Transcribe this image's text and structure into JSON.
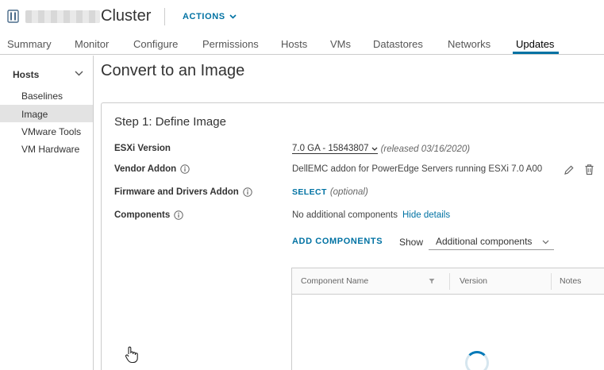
{
  "header": {
    "title": "Cluster",
    "actions_label": "ACTIONS"
  },
  "tabs": [
    {
      "label": "Summary"
    },
    {
      "label": "Monitor"
    },
    {
      "label": "Configure"
    },
    {
      "label": "Permissions"
    },
    {
      "label": "Hosts"
    },
    {
      "label": "VMs"
    },
    {
      "label": "Datastores"
    },
    {
      "label": "Networks"
    },
    {
      "label": "Updates",
      "active": true
    }
  ],
  "sidebar": {
    "section": "Hosts",
    "items": [
      {
        "label": "Baselines"
      },
      {
        "label": "Image",
        "active": true
      },
      {
        "label": "VMware Tools"
      },
      {
        "label": "VM Hardware"
      }
    ]
  },
  "main": {
    "title": "Convert to an Image",
    "step_title": "Step 1: Define Image",
    "esxi": {
      "label": "ESXi Version",
      "value": "7.0 GA - 15843807",
      "released": "(released 03/16/2020)"
    },
    "vendor_addon": {
      "label": "Vendor Addon",
      "value": "DellEMC addon for PowerEdge Servers running ESXi 7.0 A00"
    },
    "firmware": {
      "label": "Firmware and Drivers Addon",
      "select_label": "SELECT",
      "optional": "(optional)"
    },
    "components": {
      "label": "Components",
      "value": "No additional components",
      "hide_details": "Hide details"
    },
    "add_components_label": "ADD COMPONENTS",
    "show_label": "Show",
    "show_value": "Additional components",
    "grid": {
      "columns": [
        "Component Name",
        "Version",
        "Notes"
      ]
    }
  },
  "colors": {
    "accent": "#0072a3",
    "border": "#cccccc"
  },
  "icons": [
    "cluster-icon",
    "chevron-down-icon",
    "info-icon",
    "edit-icon",
    "trash-icon",
    "filter-icon",
    "loading-spinner",
    "hand-cursor-icon"
  ]
}
